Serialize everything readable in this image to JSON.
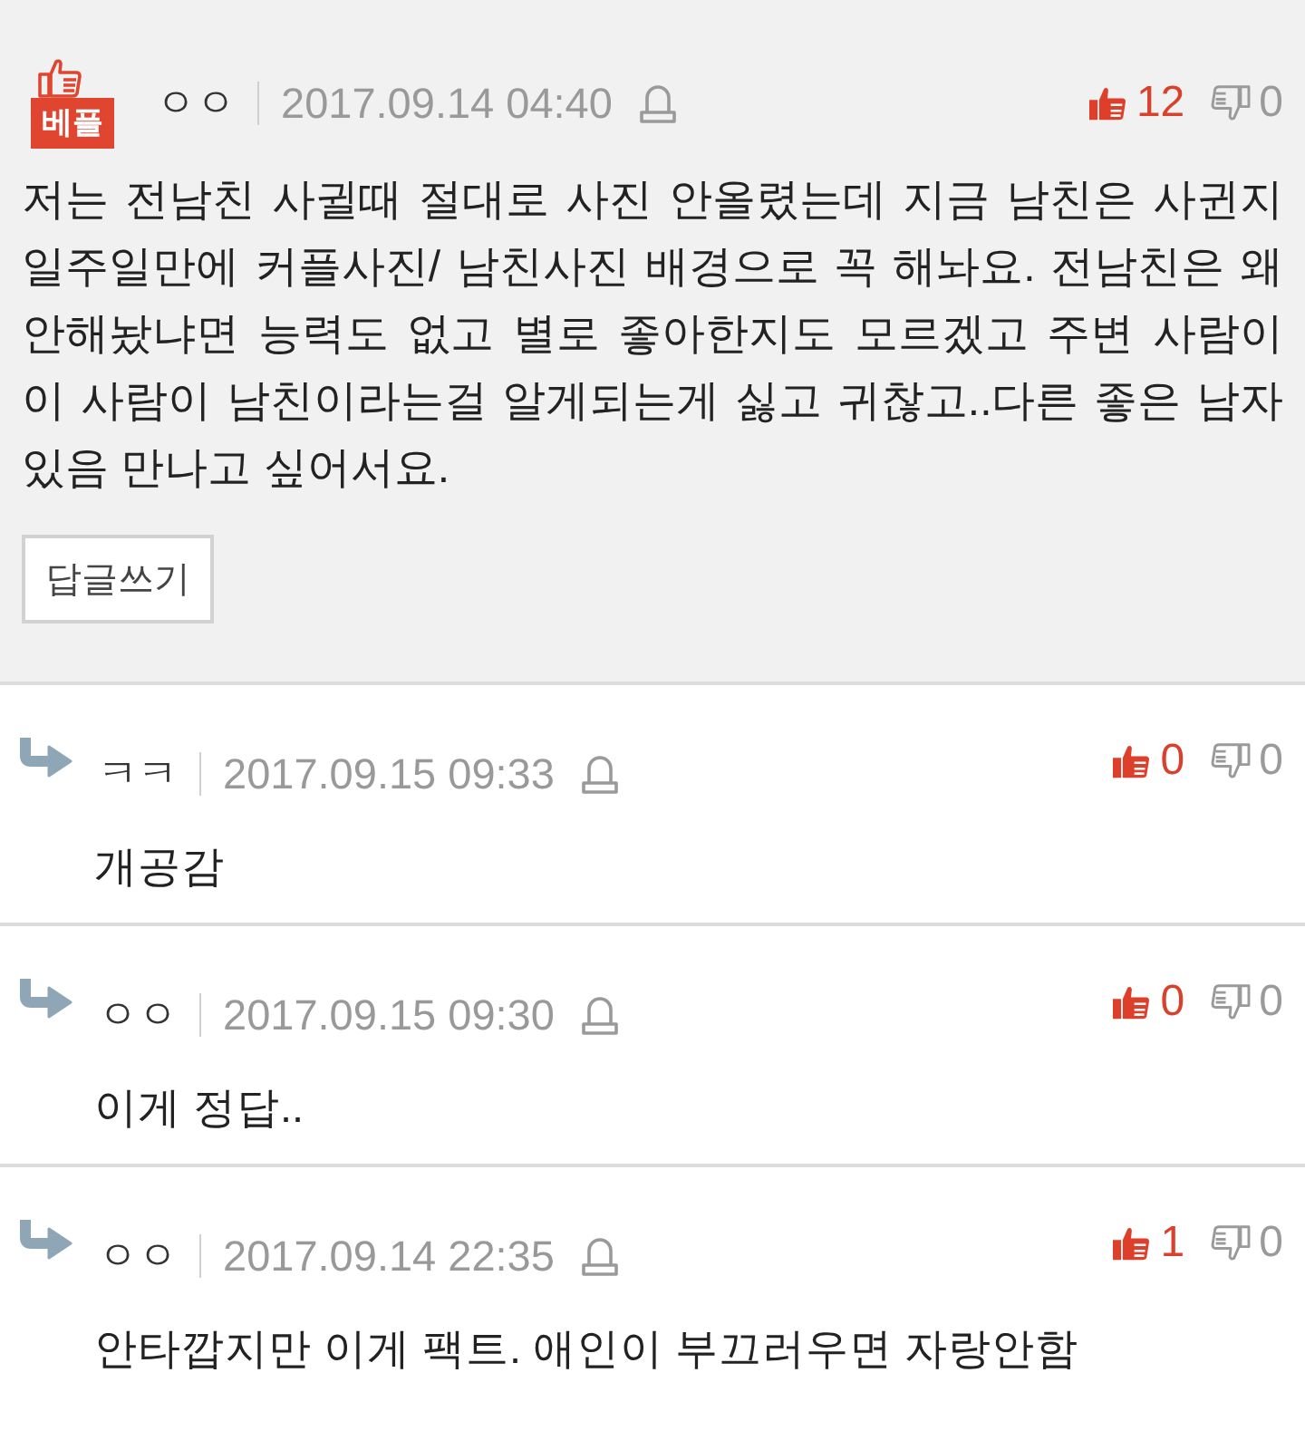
{
  "comments": [
    {
      "kind": "best",
      "badge": "베플",
      "author": "ㅇㅇ",
      "date": "2017.09.14 04:40",
      "likes": "12",
      "dislikes": "0",
      "text": "저는 전남친 사귈때 절대로 사진 안올렸는데 지금 남친은 사귄지 일주일만에 커플사진/ 남친사진 배경으로 꼭 해놔요. 전남친은 왜 안해놨냐면 능력도 없고 별로 좋아한지도 모르겠고 주변 사람이 이 사람이 남친이라는걸 알게되는게 싫고 귀찮고..다른 좋은 남자 있음 만나고 싶어서요.",
      "reply_button": "답글쓰기"
    },
    {
      "kind": "reply",
      "author": "ㅋㅋ",
      "date": "2017.09.15 09:33",
      "likes": "0",
      "dislikes": "0",
      "text": "개공감"
    },
    {
      "kind": "reply",
      "author": "ㅇㅇ",
      "date": "2017.09.15 09:30",
      "likes": "0",
      "dislikes": "0",
      "text": "이게 정답.."
    },
    {
      "kind": "reply",
      "author": "ㅇㅇ",
      "date": "2017.09.14 22:35",
      "likes": "1",
      "dislikes": "0",
      "text": "안타깝지만 이게 팩트. 애인이 부끄러우면 자랑안함"
    }
  ]
}
